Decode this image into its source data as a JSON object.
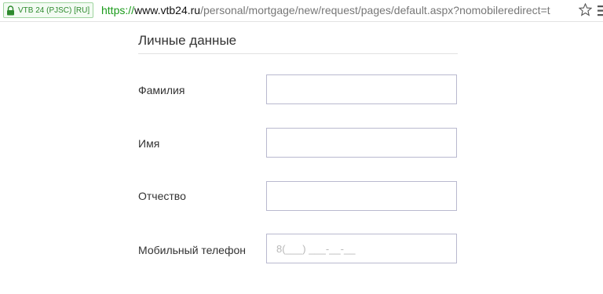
{
  "browser": {
    "ev_label": "VTB 24 (PJSC) [RU]",
    "url_scheme": "https://",
    "url_host": "www.vtb24.ru",
    "url_path": "/personal/mortgage/new/request/pages/default.aspx?nomobileredirect=t",
    "secure_color": "#1a9a1a"
  },
  "form": {
    "section_title": "Личные данные",
    "fields": [
      {
        "label": "Фамилия",
        "value": "",
        "placeholder": ""
      },
      {
        "label": "Имя",
        "value": "",
        "placeholder": ""
      },
      {
        "label": "Отчество",
        "value": "",
        "placeholder": ""
      },
      {
        "label": "Мобильный телефон",
        "value": "",
        "placeholder": "8(___) ___-__-__"
      }
    ]
  }
}
